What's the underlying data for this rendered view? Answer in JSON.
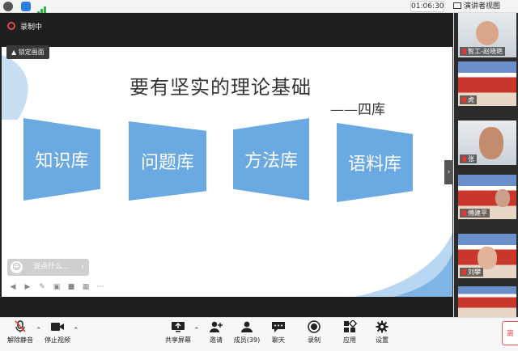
{
  "status_bar": {
    "timer": "01:06:30",
    "speaker_view": "演讲者视图"
  },
  "recording": {
    "label": "录制中"
  },
  "lock_button": {
    "label": "锁定画面"
  },
  "slide": {
    "title": "要有坚实的理论基础",
    "subtitle": "——四库",
    "boxes": [
      "知识库",
      "问题库",
      "方法库",
      "语料库"
    ]
  },
  "chat": {
    "placeholder": "说点什么..."
  },
  "participants": [
    {
      "name": "智工-赵晓艳"
    },
    {
      "name": "虎"
    },
    {
      "name": "张"
    },
    {
      "name": "傅建平"
    },
    {
      "name": "刘攀"
    }
  ],
  "toolbar": {
    "unmute": "解除静音",
    "stop_video": "停止视频",
    "share": "共享屏幕",
    "invite": "邀请",
    "members": "成员(39)",
    "chat": "聊天",
    "record": "录制",
    "apps": "应用",
    "settings": "设置",
    "leave": "离"
  },
  "colors": {
    "accent_blue": "#6aa9e2",
    "record_red": "#e04a4a"
  }
}
